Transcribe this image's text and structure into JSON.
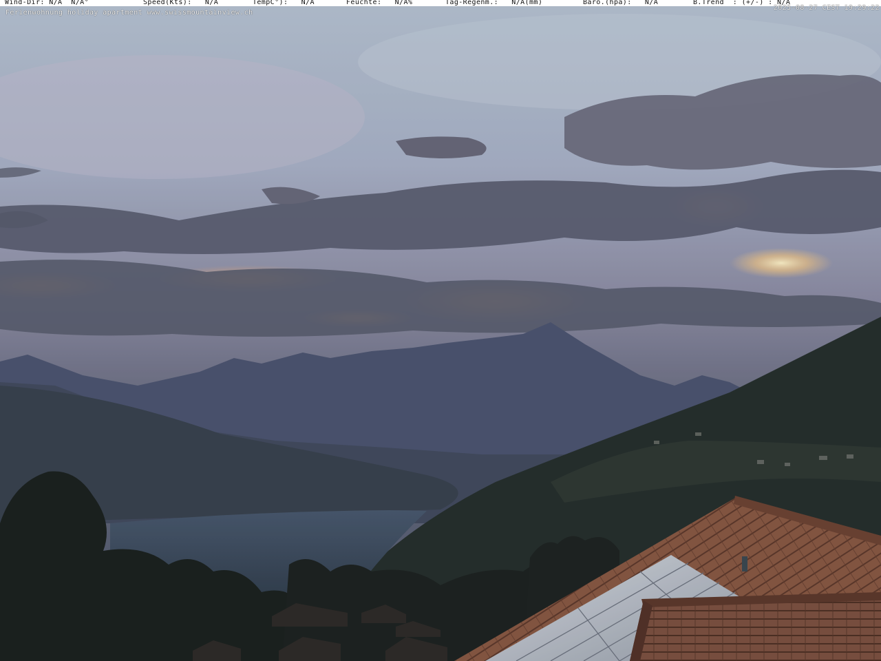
{
  "overlay": {
    "wind_dir": "Wind-Dir: N/A  N/A°",
    "speed": "Speed(Kts):   N/A",
    "temp": "TempC°):   N/A",
    "humidity": "Feuchte:   N/A%",
    "rain": "Tag-Regenm.:   N/A(mm)",
    "baro": "Baro.(hpa):   N/A",
    "trend": "B.Trend  : (+/-) : N/A",
    "caption": "Ferienwohnung holiday apartment www.swissmountainview.ch",
    "timestamp": "2025-08-27 CEST 19:29:22"
  },
  "colors": {
    "sky_top": "#b9c6d6",
    "cloud_dark": "#5b5f70",
    "sunset_glow": "#f4c98a",
    "mountain_far": "#4a5470",
    "lake": "#3f5064",
    "roof_tile": "#8a5a45",
    "solar_panel": "#c7ccd4"
  }
}
